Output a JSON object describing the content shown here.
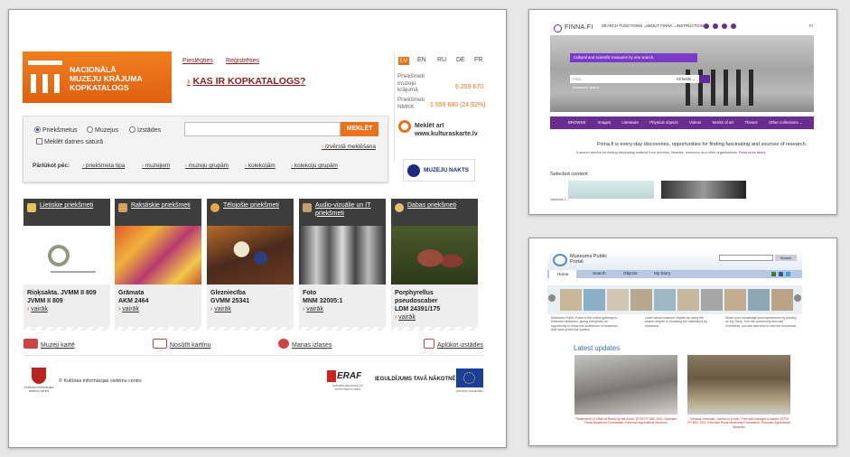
{
  "lv": {
    "logo_line1": "NACIONĀLĀ",
    "logo_line2": "MUZEJU KRĀJUMA",
    "logo_line3": "KOPKATALOGS",
    "login": "Pieslēgties",
    "register": "Reģistrēties",
    "kas": "KAS IR KOPKATALOGS?",
    "langs": [
      "LV",
      "EN",
      "RU",
      "DE",
      "FR"
    ],
    "stat1_label_1": "Priekšmeti",
    "stat1_label_2": "muzeju",
    "stat1_label_3": "krājumā",
    "stat1_value": "6 259 670",
    "stat2_label_1": "Priekšmeti",
    "stat2_label_2": "NMKK",
    "stat2_value": "1 559 680 (24.92%)",
    "radios": [
      "Priekšmetus",
      "Muzejus",
      "Izstādes"
    ],
    "search_button": "MEKLĒT",
    "checkbox": "Meklēt datnes saturā",
    "advanced": "Izvērstā meklēšana",
    "browse_label": "Pārlūkot pēc:",
    "browse": [
      "priekšmeta tipa",
      "muzejiem",
      "muzeju grupām",
      "kolekcijām",
      "kolekciju grupām"
    ],
    "also_1": "Meklēt arī",
    "also_2": "www.kulturaskarte.lv",
    "museum_night": "MUZEJU NAKTS",
    "tiles": [
      {
        "head": "Lietiskie priekšmeti",
        "t1": "Riņķsakta. JVMM II 809",
        "t2": "JVMM II 809",
        "more": "vairāk"
      },
      {
        "head": "Rakstiskie priekšmeti",
        "t1": "Grāmata",
        "t2": "AKM 2464",
        "more": "vairāk"
      },
      {
        "head": "Tēlojošie priekšmeti",
        "t1": "Glezniecība",
        "t2": "GVMM 25341",
        "more": "vairāk"
      },
      {
        "head": "Audio-vizuālie un IT priekšmeti",
        "t1": "Foto",
        "t2": "MNM 32005:1",
        "more": "vairāk"
      },
      {
        "head": "Dabas priekšmeti",
        "t1": "Porphyrellus",
        "t2": "pseudoscaber",
        "t3": "LDM 24391/175",
        "more": "vairāk"
      }
    ],
    "footer": [
      "Muzeji kartē",
      "Nosūtīt kartīņu",
      "Manas izlases",
      "Aplūkot izstādes"
    ],
    "copyright": "© Kultūras informācijas sistēmu centrs",
    "kiscg": "Kultūras informācijas sistēmu centrs",
    "eraf": "ERAF",
    "eraf_sub": "EIROPAS REĢIONĀLĀS ATTĪSTĪBAS FONDS",
    "invest": "IEGULDĪJUMS TAVĀ NĀKOTNĒ",
    "eu_sub": "EIROPAS SAVIENĪBA"
  },
  "fi": {
    "logo": "FINNA.FI",
    "nav": [
      "SEARCH FUNCTIONS ⌄",
      "ABOUT FINNA ⌄",
      "INSTRUCTIONS"
    ],
    "lang": "FI",
    "banner": "Cultural and scientific treasures by one search.",
    "search_placeholder": "Find...",
    "all_fields": "All fields ⌄",
    "advanced": "Advanced search",
    "browse": "BROWSE",
    "cats": [
      "Images",
      "Literature",
      "Physical objects",
      "Videos",
      "Works of art",
      "Theses",
      "Other collections ⌄"
    ],
    "desc": "Finna.fi is every-day discoveries, opportunities for finding fascinating and sources of research.",
    "desc2": "A search service for finding fascinating material from archives, libraries, museums and other organisations.",
    "read_more": "Read more about",
    "selected": "Selected content",
    "selected_small": "Valokuva 1..."
  },
  "ee": {
    "title1": "Museums Public",
    "title2": "Portal",
    "search": "Search",
    "tabs": [
      "Home",
      "Search",
      "Objects",
      "My Story"
    ],
    "latest": "Latest updates",
    "intro1": "Museums Public Portal is the online gateway to Estonian museums, giving everybody an opportunity to study the collections of museums that have joined the system.",
    "intro2": "Learn about museum objects by using the search engine or browsing the collections by museums.",
    "intro3": "Share your knowledge and experiences by posting on My Story. Join the community and add comments, you are welcome to visit the museums!",
    "cap1": "\"Settlement of Oflak at Rirma by the Anna\" (ETM FP 583: 300). Estonian Rural Museums Foundation, Estonian Agricultural Museum",
    "cap2": "\"Serious criminals - karma to a man. Free will manager is asked\" (ETM FP 583: 292). Estonian Rural Museums Foundation, Estonian Agricultural Museum"
  }
}
